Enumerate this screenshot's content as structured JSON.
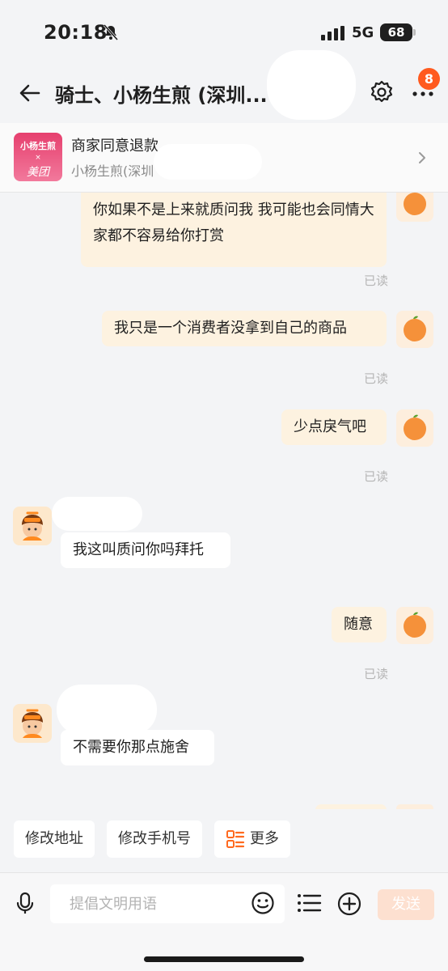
{
  "status_bar": {
    "time": "20:18",
    "network": "5G",
    "battery": "68"
  },
  "header": {
    "title": "骑士、小杨生煎 (深圳...",
    "badge_count": "8"
  },
  "order_card": {
    "logo_line1": "小杨生煎",
    "logo_line2": "×",
    "logo_line3": "美团",
    "title": "商家同意退款",
    "subtitle": "小杨生煎(深圳"
  },
  "messages": [
    {
      "from": "me",
      "text": "你如果不是上来就质问我 我可能也会同情大家都不容易给你打赏",
      "status": "已读"
    },
    {
      "from": "me",
      "text": "我只是一个消费者没拿到自己的商品",
      "status": "已读"
    },
    {
      "from": "me",
      "text": "少点戾气吧",
      "status": "已读"
    },
    {
      "from": "rider",
      "text": "我这叫质问你吗拜托"
    },
    {
      "from": "me",
      "text": "随意",
      "status": "已读"
    },
    {
      "from": "rider",
      "text": "不需要你那点施舍"
    }
  ],
  "quick_actions": [
    {
      "label": "修改地址"
    },
    {
      "label": "修改手机号"
    },
    {
      "label": "更多"
    }
  ],
  "input": {
    "placeholder": "提倡文明用语",
    "send_label": "发送"
  },
  "colors": {
    "accent": "#ff5a1f",
    "bubble_out": "#fdf2e0",
    "bubble_in": "#ffffff",
    "send_disabled": "#fde0d0"
  }
}
